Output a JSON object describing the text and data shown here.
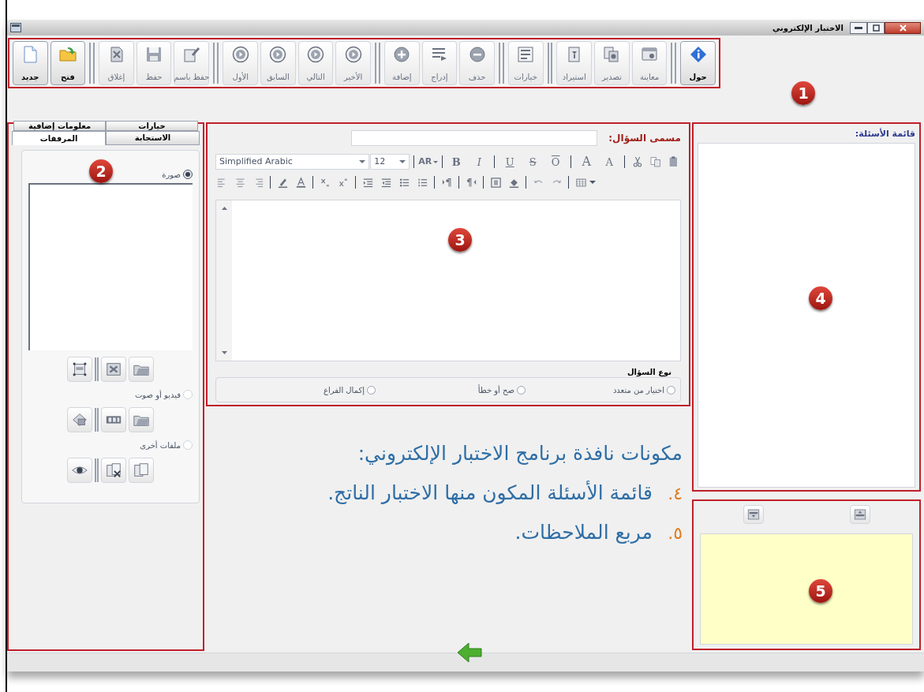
{
  "window": {
    "title": "الاختبار الإلكتروني"
  },
  "toolbar": {
    "groups": [
      {
        "buttons": [
          {
            "label": "حول",
            "disabled": false
          }
        ]
      },
      {
        "buttons": [
          {
            "label": "معاينة",
            "disabled": true
          },
          {
            "label": "تصدير",
            "disabled": true
          },
          {
            "label": "استيراد",
            "disabled": true
          }
        ]
      },
      {
        "buttons": [
          {
            "label": "خيارات",
            "disabled": true
          }
        ]
      },
      {
        "buttons": [
          {
            "label": "حذف",
            "disabled": true
          },
          {
            "label": "إدراج",
            "disabled": true
          },
          {
            "label": "إضافة",
            "disabled": true
          }
        ]
      },
      {
        "buttons": [
          {
            "label": "الأخير",
            "disabled": true
          },
          {
            "label": "التالي",
            "disabled": true
          },
          {
            "label": "السابق",
            "disabled": true
          },
          {
            "label": "الأول",
            "disabled": true
          }
        ]
      },
      {
        "buttons": [
          {
            "label": "حفظ باسم",
            "disabled": true
          },
          {
            "label": "حفظ",
            "disabled": true
          },
          {
            "label": "إغلاق",
            "disabled": true
          }
        ]
      },
      {
        "buttons": [
          {
            "label": "فتح",
            "disabled": false
          },
          {
            "label": "جديد",
            "disabled": false
          }
        ]
      }
    ]
  },
  "left_panel": {
    "tab_rows": [
      [
        {
          "label": "خيارات",
          "selected": false
        },
        {
          "label": "معلومات إضافية",
          "selected": false
        }
      ],
      [
        {
          "label": "الاستجابة",
          "selected": false
        },
        {
          "label": "المرفقات",
          "selected": true
        }
      ]
    ],
    "attachments": [
      {
        "kind": "image",
        "label": "صورة",
        "selected": true
      },
      {
        "kind": "media",
        "label": "فيديو أو صوت",
        "selected": false
      },
      {
        "kind": "files",
        "label": "ملفات أخرى",
        "selected": false
      }
    ]
  },
  "question_editor": {
    "name_label": "مسمى السؤال:",
    "font": "Simplified Arabic",
    "size": "12",
    "language": "AR",
    "text_buttons": [
      {
        "kind": "shrink",
        "label": "A"
      },
      {
        "kind": "grow",
        "label": "A"
      },
      {
        "kind": "overline",
        "label": "O"
      },
      {
        "kind": "strike",
        "label": "S"
      },
      {
        "kind": "underline",
        "label": "U"
      },
      {
        "kind": "italic",
        "label": "I"
      },
      {
        "kind": "bold",
        "label": "B"
      }
    ],
    "question_type": {
      "title": "نوع السؤال",
      "options": [
        {
          "label": "اختيار من متعدد",
          "selected": false
        },
        {
          "label": "صح أو خطأ",
          "selected": false
        },
        {
          "label": "إكمال الفراغ",
          "selected": false
        }
      ]
    }
  },
  "slide_text": {
    "heading": "مكونات نافذة برنامج الاختبار الإلكتروني:",
    "items": [
      {
        "number": "٤.",
        "text": "قائمة الأسئلة المكون منها الاختبار الناتج."
      },
      {
        "number": "٥.",
        "text": "مربع الملاحظات."
      }
    ]
  },
  "questions_list": {
    "label": "قائمة الأسئلة:"
  },
  "annotations": [
    {
      "number": "1"
    },
    {
      "number": "2"
    },
    {
      "number": "3"
    },
    {
      "number": "4"
    },
    {
      "number": "5"
    }
  ]
}
